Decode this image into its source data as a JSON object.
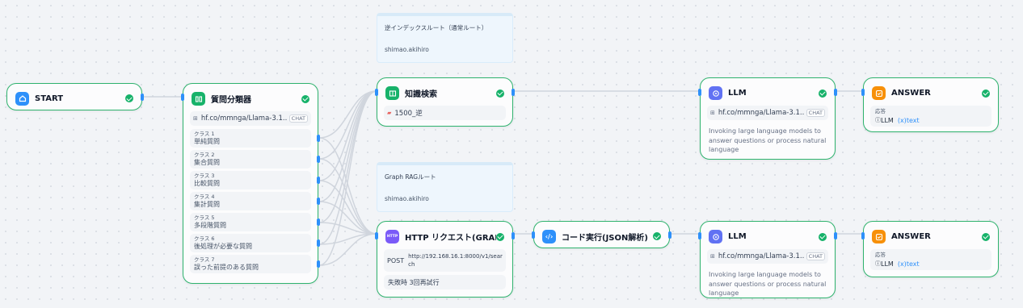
{
  "nodes": {
    "start": {
      "title": "START",
      "icon": "home-icon",
      "color": "#2e90fa"
    },
    "classifier": {
      "title": "質問分類器",
      "icon": "classifier-icon",
      "color": "#17b26a",
      "model": "hf.co/mmnga/Llama-3.1...",
      "model_tag": "CHAT",
      "classes": [
        {
          "label": "クラス 1",
          "value": "単純質問"
        },
        {
          "label": "クラス 2",
          "value": "集合質問"
        },
        {
          "label": "クラス 3",
          "value": "比較質問"
        },
        {
          "label": "クラス 4",
          "value": "集計質問"
        },
        {
          "label": "クラス 5",
          "value": "多段階質問"
        },
        {
          "label": "クラス 6",
          "value": "後処理が必要な質問"
        },
        {
          "label": "クラス 7",
          "value": "誤った前提のある質問"
        }
      ]
    },
    "knowledge": {
      "title": "知識検索",
      "icon": "book-icon",
      "color": "#17b26a",
      "dataset": "1500_逆"
    },
    "http": {
      "title": "HTTP リクエスト(GRAPHRAGサ",
      "icon": "http-icon",
      "icon_text": "HTTP",
      "color": "#7a5af8",
      "method": "POST",
      "url": "http://192.168.16.1:8000/v1/search",
      "retry": "失敗時 3回再試行"
    },
    "code": {
      "title": "コード実行(JSON解析)",
      "icon": "code-icon",
      "color": "#2e90fa"
    },
    "llm1": {
      "title": "LLM",
      "icon": "llm-icon",
      "color": "#6172f3",
      "model": "hf.co/mmnga/Llama-3.1...",
      "model_tag": "CHAT",
      "description": "Invoking large language models to answer questions or process natural language"
    },
    "llm2": {
      "title": "LLM",
      "icon": "llm-icon",
      "color": "#6172f3",
      "model": "hf.co/mmnga/Llama-3.1...",
      "model_tag": "CHAT",
      "description": "Invoking large language models to answer questions or process natural language"
    },
    "answer1": {
      "title": "ANSWER",
      "icon": "answer-icon",
      "color": "#f79009",
      "var_label": "応答",
      "var_source": "LLM",
      "var_name": "text"
    },
    "answer2": {
      "title": "ANSWER",
      "icon": "answer-icon",
      "color": "#f79009",
      "var_label": "応答",
      "var_source": "LLM",
      "var_name": "text"
    }
  },
  "notes": [
    {
      "text": "逆インデックスルート（通常ルート）",
      "author": "shimao.akihiro"
    },
    {
      "text": "Graph RAGルート",
      "author": "shimao.akihiro"
    }
  ],
  "colors": {
    "edge": "#d0d5dd",
    "port": "#2e90fa",
    "success_border": "#2fb36e"
  }
}
